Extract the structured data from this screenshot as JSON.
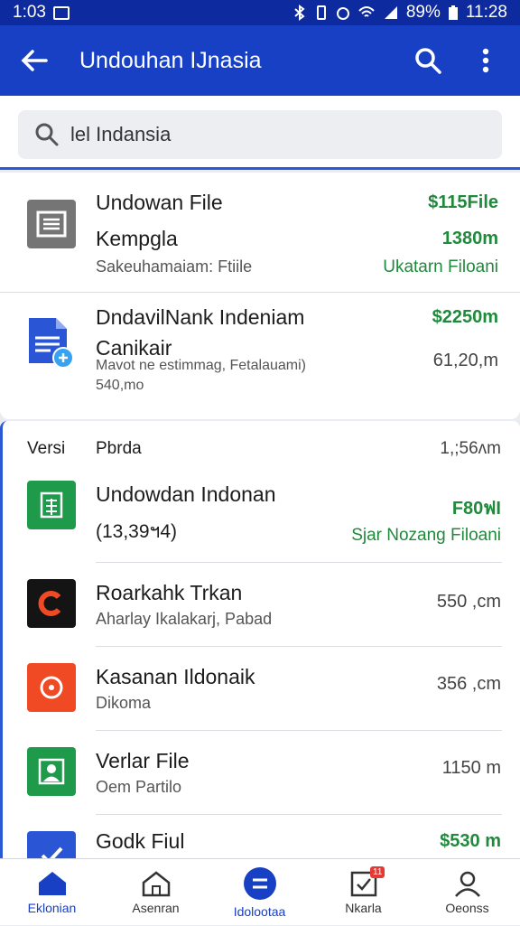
{
  "status": {
    "time": "1:03",
    "right_text": "89%",
    "clock": "11:28"
  },
  "appbar": {
    "title": "Undouhan IJnasia"
  },
  "search": {
    "value": "lel Indansia"
  },
  "card1": {
    "items": [
      {
        "name": "Undowan File",
        "name2": "Kempgla",
        "sub": "Sakeuhamaiam: Ftiile",
        "price": "$115File",
        "size": "1380m",
        "status": "Ukatarn Filoani",
        "icon": "document-icon",
        "icon_color": "#757575"
      },
      {
        "name": "DndavilNank Indeniam",
        "name2": "Canikair",
        "sub": "Mavot ne estimmag, Fetalauami)",
        "sub2": "540,mo",
        "price": "$2250m",
        "size": "61,20,m",
        "icon": "docs-icon",
        "icon_color": "#2a56d6"
      }
    ]
  },
  "card2": {
    "header": {
      "col1": "Versi",
      "col2": "Pbrda",
      "col3": "1,;56ʌm"
    },
    "items": [
      {
        "name": "Undowdan Indonan",
        "sub": "(13,39ฯ4)",
        "price": "F80ฟI",
        "status": "Sjar Nozang Filoani",
        "icon": "sheets-icon",
        "icon_color": "#1e9a4a"
      },
      {
        "name": "Roarkahk Trkan",
        "sub": "Aharlay Ikalakarj, Pabad",
        "size": "550 ,cm",
        "icon": "app-icon",
        "icon_color": "#141414"
      },
      {
        "name": "Kasanan Ildonaik",
        "sub": "Dikoma",
        "size": "356 ,cm",
        "icon": "record-icon",
        "icon_color": "#ef4a23"
      },
      {
        "name": "Verlar File",
        "sub": "Oem Partilo",
        "size": "1150 m",
        "icon": "contact-icon",
        "icon_color": "#1e9a4a"
      },
      {
        "name": "Godk Fiul",
        "price": "$530 m",
        "icon": "check-icon",
        "icon_color": "#2a56d6"
      }
    ]
  },
  "nav": [
    {
      "label": "Eklonian",
      "icon": "home-icon"
    },
    {
      "label": "Asenran",
      "icon": "house-icon"
    },
    {
      "label": "Idolootaa",
      "icon": "equal-icon"
    },
    {
      "label": "Nkarla",
      "icon": "inbox-icon",
      "badge": "11"
    },
    {
      "label": "Oeonss",
      "icon": "person-icon"
    }
  ]
}
